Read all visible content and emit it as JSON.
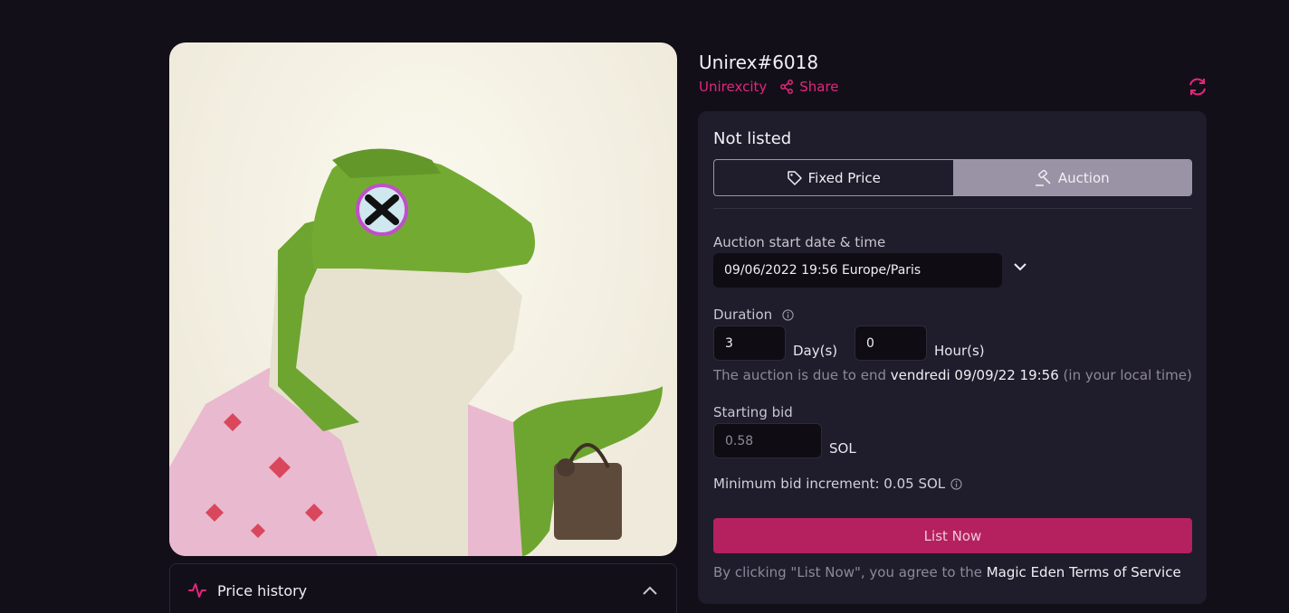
{
  "nft": {
    "title": "Unirex#6018",
    "collection": "Unirexcity",
    "share_label": "Share"
  },
  "price_history": {
    "label": "Price history"
  },
  "listing": {
    "status": "Not listed",
    "tabs": [
      {
        "label": "Fixed Price",
        "icon": "tag-icon",
        "active": false
      },
      {
        "label": "Auction",
        "icon": "gavel-icon",
        "active": true
      }
    ],
    "start_label": "Auction start date & time",
    "start_value": "09/06/2022 19:56 Europe/Paris",
    "duration_label": "Duration",
    "days_value": "3",
    "days_unit": "Day(s)",
    "hours_value": "0",
    "hours_unit": "Hour(s)",
    "end_note_prefix": "The auction is due to end ",
    "end_note_date": "vendredi 09/09/22 19:56",
    "end_note_suffix": " (in your local time)",
    "starting_bid_label": "Starting bid",
    "starting_bid_placeholder": "0.58",
    "starting_bid_unit": "SOL",
    "min_increment": "Minimum bid increment: 0.05 SOL",
    "list_button": "List Now",
    "terms_prefix": "By clicking \"List Now\", you agree to the ",
    "terms_link": "Magic Eden Terms of Service"
  },
  "colors": {
    "accent": "#e4267a",
    "button": "#b5215f",
    "panel": "#1f1c2b",
    "background": "#130f19"
  }
}
